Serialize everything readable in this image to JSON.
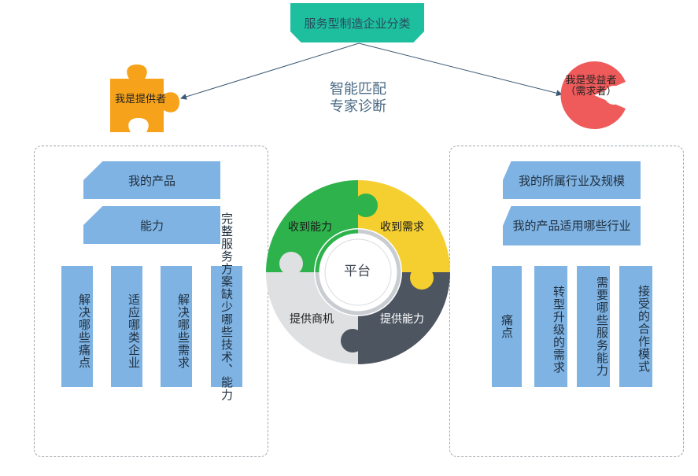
{
  "title": "服务型制造企业分类",
  "provider": {
    "label": "我是提供者"
  },
  "receiver": {
    "label": "我是受益者（需求者）"
  },
  "center": {
    "line1": "智能匹配",
    "line2": "专家诊断"
  },
  "left_panel": {
    "bars": [
      "我的产品",
      "能力"
    ],
    "columns": [
      "解决哪些痛点",
      "适应哪类企业",
      "解决哪些需求",
      "完整服务方案缺少哪些技术、能力"
    ]
  },
  "right_panel": {
    "bars": [
      "我的所属行业及规模",
      "我的产品适用哪些行业"
    ],
    "columns": [
      "痛点",
      "转型升级的需求",
      "需要哪些服务能力",
      "接受的合作模式"
    ]
  },
  "wheel": {
    "top_left": "收到能力",
    "top_right": "收到需求",
    "bottom_left": "提供商机",
    "bottom_right": "提供能力",
    "center": "平台"
  },
  "colors": {
    "title_bg": "#1dbf9f",
    "puzzle_orange": "#f7a21b",
    "receiver_red": "#ef5b5b",
    "bar_blue": "#7fb3e3",
    "wheel_green": "#2eb24c",
    "wheel_yellow": "#f5cf2f",
    "wheel_gray": "#dfe0e2",
    "wheel_dark": "#4d5560"
  }
}
